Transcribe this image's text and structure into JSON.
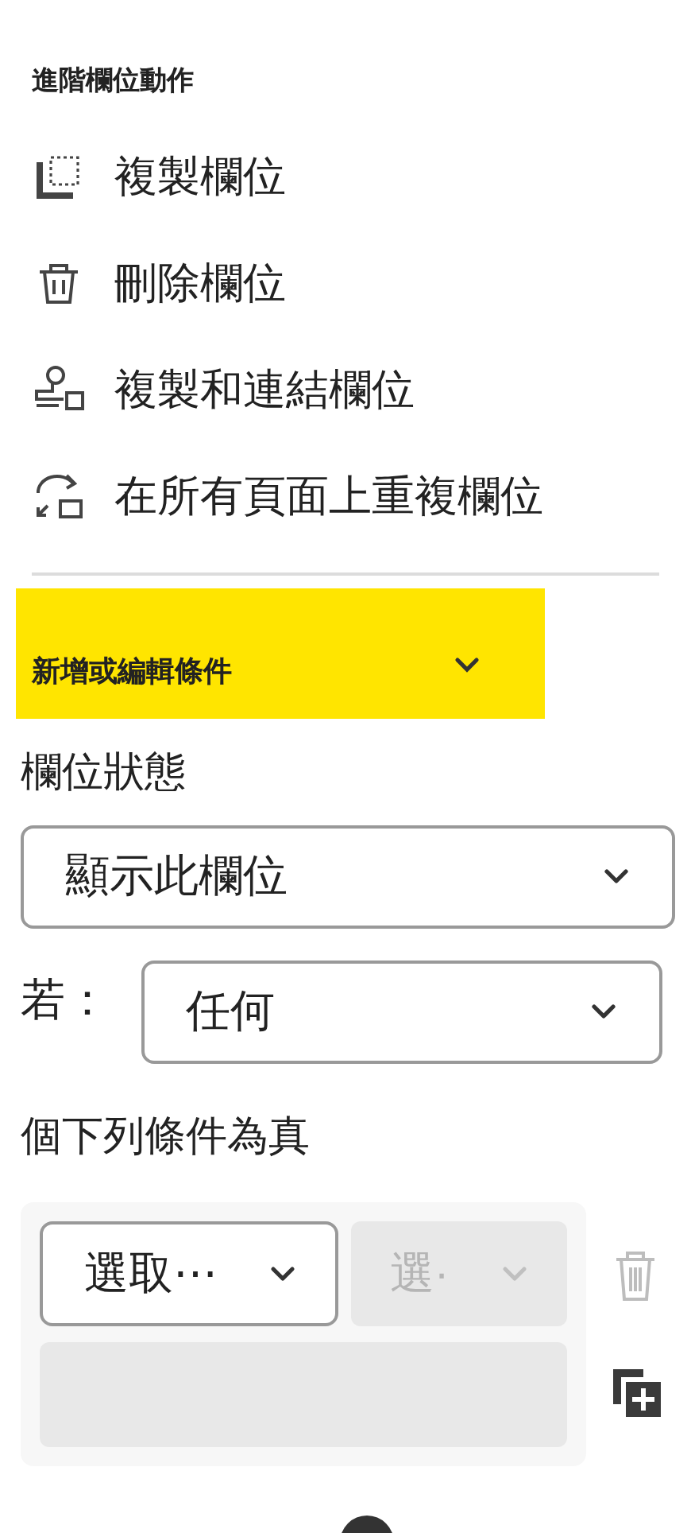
{
  "advanced_actions": {
    "title": "進階欄位動作",
    "items": [
      {
        "kind": "copy",
        "label": "複製欄位"
      },
      {
        "kind": "delete",
        "label": "刪除欄位"
      },
      {
        "kind": "link",
        "label": "複製和連結欄位"
      },
      {
        "kind": "repeat",
        "label": "在所有頁面上重複欄位"
      }
    ]
  },
  "conditions": {
    "title": "新增或編輯條件",
    "expanded": true,
    "status_label": "欄位狀態",
    "status_value": "顯示此欄位",
    "if_label": "若：",
    "if_value": "任何",
    "suffix": "個下列條件為真",
    "rule": {
      "selects": [
        {
          "value": "選取⋯",
          "disabled": false
        },
        {
          "value": "選·",
          "disabled": true
        }
      ]
    }
  }
}
